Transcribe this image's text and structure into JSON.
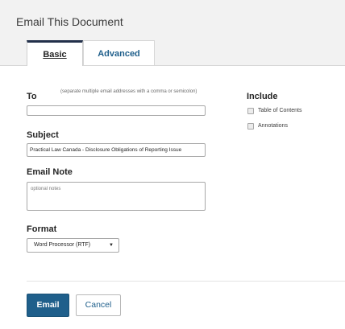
{
  "dialog": {
    "title": "Email This Document"
  },
  "tabs": {
    "basic": "Basic",
    "advanced": "Advanced"
  },
  "to": {
    "label": "To",
    "hint": "(separate multiple email addresses with a comma or semicolon)",
    "value": ""
  },
  "subject": {
    "label": "Subject",
    "value": "Practical Law Canada - Disclosure Obligations of Reporting Issue"
  },
  "note": {
    "label": "Email Note",
    "placeholder": "optional notes"
  },
  "format": {
    "label": "Format",
    "selected": "Word Processor (RTF)"
  },
  "include": {
    "label": "Include",
    "options": [
      {
        "label": "Table of Contents",
        "checked": false
      },
      {
        "label": "Annotations",
        "checked": false
      }
    ]
  },
  "buttons": {
    "email": "Email",
    "cancel": "Cancel"
  },
  "colors": {
    "accent": "#1f5f8b",
    "tab_active_border": "#22304a",
    "header_bg": "#f2f2f2"
  },
  "icons": {
    "dropdown": "triangle-down-icon"
  }
}
